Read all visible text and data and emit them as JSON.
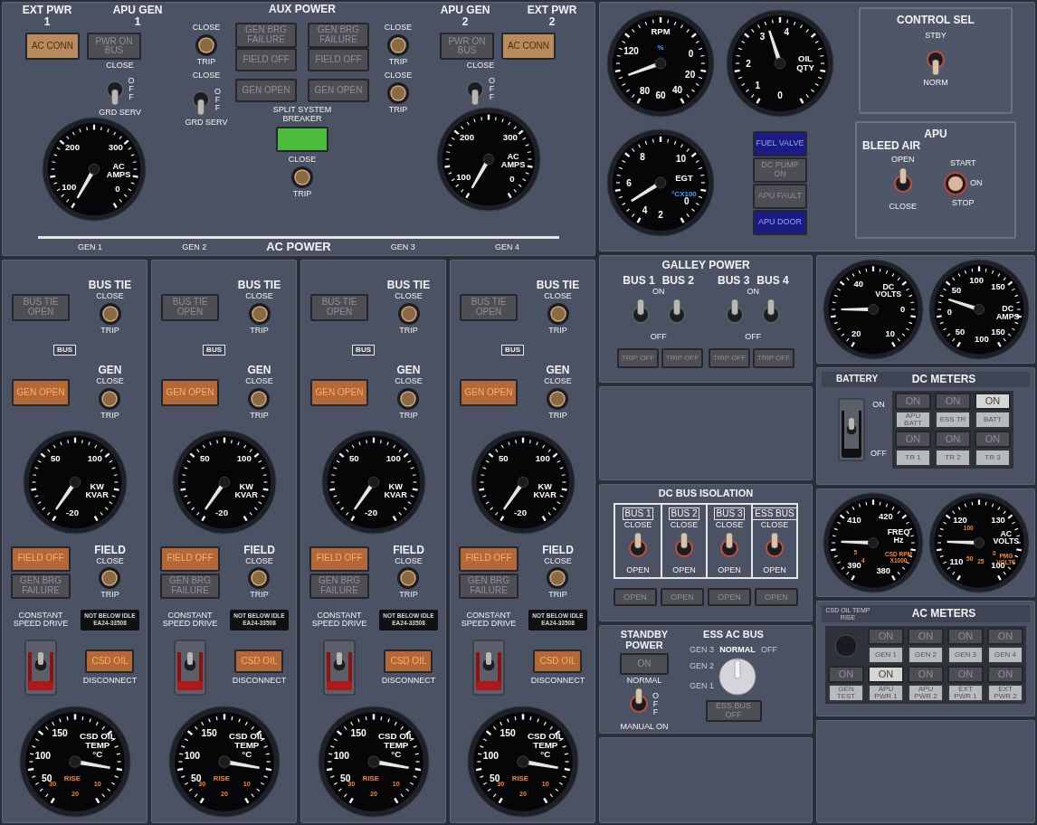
{
  "aux_power": {
    "title": "AUX POWER",
    "left": {
      "headings": [
        "EXT PWR 1",
        "APU GEN 1"
      ],
      "lights": [
        {
          "text": "AC CONN",
          "lit": true
        },
        {
          "text": "PWR ON BUS",
          "lit": false
        }
      ],
      "switch": {
        "top": "CLOSE",
        "side": "OFF",
        "bottom": "GRD SERV",
        "up": false
      },
      "gauge": {
        "caption": [
          "AC",
          "AMPS"
        ],
        "labels": [
          "200",
          "300",
          "100",
          "0"
        ]
      }
    },
    "inner_left": {
      "breaker": {
        "top": "CLOSE",
        "bottom": "TRIP"
      },
      "switch": {
        "top": "CLOSE",
        "side": "OFF",
        "bottom": "GRD SERV",
        "up": false
      }
    },
    "center": {
      "light_columns": [
        [
          {
            "text": "GEN BRG FAILURE",
            "lit": false
          },
          {
            "text": "FIELD OFF",
            "lit": false
          },
          {
            "text": "GEN OPEN",
            "lit": false
          }
        ],
        [
          {
            "text": "GEN BRG FAILURE",
            "lit": false
          },
          {
            "text": "FIELD OFF",
            "lit": false
          },
          {
            "text": "GEN OPEN",
            "lit": false
          }
        ]
      ],
      "breaker_label": "SPLIT SYSTEM BREAKER",
      "breaker_lit": true,
      "breaker": {
        "top": "CLOSE",
        "bottom": "TRIP"
      }
    },
    "inner_right": {
      "breakers": [
        {
          "top": "CLOSE",
          "bottom": "TRIP"
        },
        {
          "top": "CLOSE",
          "bottom": "TRIP"
        }
      ]
    },
    "right": {
      "headings": [
        "APU GEN 2",
        "EXT PWR 2"
      ],
      "lights": [
        {
          "text": "PWR ON BUS",
          "lit": false
        },
        {
          "text": "AC CONN",
          "lit": true
        }
      ],
      "switch": {
        "top": "CLOSE",
        "side": "OFF",
        "up": false
      },
      "gauge": {
        "caption": [
          "AC",
          "AMPS"
        ],
        "labels": [
          "200",
          "300",
          "100",
          "0"
        ]
      }
    },
    "bus_labels": [
      "GEN 1",
      "GEN 2",
      "GEN 3",
      "GEN 4"
    ],
    "footer": "AC POWER"
  },
  "generators": [
    {
      "bus_tie": {
        "title": "BUS TIE",
        "top": "CLOSE",
        "bottom": "TRIP",
        "light": {
          "text": "BUS TIE OPEN",
          "lit": false
        }
      },
      "bus_tag": "BUS",
      "gen": {
        "title": "GEN",
        "top": "CLOSE",
        "bottom": "TRIP",
        "light": {
          "text": "GEN OPEN",
          "lit": true
        }
      },
      "gauge": {
        "caption": [
          "KW",
          "KVAR"
        ],
        "labels": [
          "50",
          "100",
          "-20"
        ]
      },
      "field": {
        "title": "FIELD",
        "top": "CLOSE",
        "bottom": "TRIP",
        "light": {
          "text": "FIELD OFF",
          "lit": true
        }
      },
      "failure_light": {
        "text": "GEN BRG FAILURE",
        "lit": false
      },
      "csd_label": "CONSTANT SPEED DRIVE",
      "placard": [
        "NOT BELOW IDLE",
        "EA24-33508"
      ],
      "csd_light": {
        "text": "CSD OIL",
        "lit": true
      },
      "disconnect": {
        "label": "DISCONNECT",
        "up": true
      },
      "temp_gauge": {
        "caption": [
          "CSD OIL",
          "TEMP",
          "°C"
        ],
        "labels": [
          "50",
          "100",
          "150"
        ],
        "inner_labels": [
          "30",
          "20",
          "10"
        ],
        "inner_caption": "RISE"
      }
    },
    {
      "bus_tie": {
        "title": "BUS TIE",
        "top": "CLOSE",
        "bottom": "TRIP",
        "light": {
          "text": "BUS TIE OPEN",
          "lit": false
        }
      },
      "bus_tag": "BUS",
      "gen": {
        "title": "GEN",
        "top": "CLOSE",
        "bottom": "TRIP",
        "light": {
          "text": "GEN OPEN",
          "lit": true
        }
      },
      "gauge": {
        "caption": [
          "KW",
          "KVAR"
        ],
        "labels": [
          "50",
          "100",
          "-20"
        ]
      },
      "field": {
        "title": "FIELD",
        "top": "CLOSE",
        "bottom": "TRIP",
        "light": {
          "text": "FIELD OFF",
          "lit": true
        }
      },
      "failure_light": {
        "text": "GEN BRG FAILURE",
        "lit": false
      },
      "csd_label": "CONSTANT SPEED DRIVE",
      "placard": [
        "NOT BELOW IDLE",
        "EA24-33508"
      ],
      "csd_light": {
        "text": "CSD OIL",
        "lit": true
      },
      "disconnect": {
        "label": "DISCONNECT",
        "up": true
      },
      "temp_gauge": {
        "caption": [
          "CSD OIL",
          "TEMP",
          "°C"
        ],
        "labels": [
          "50",
          "100",
          "150"
        ],
        "inner_labels": [
          "30",
          "20",
          "10"
        ],
        "inner_caption": "RISE"
      }
    },
    {
      "bus_tie": {
        "title": "BUS TIE",
        "top": "CLOSE",
        "bottom": "TRIP",
        "light": {
          "text": "BUS TIE OPEN",
          "lit": false
        }
      },
      "bus_tag": "BUS",
      "gen": {
        "title": "GEN",
        "top": "CLOSE",
        "bottom": "TRIP",
        "light": {
          "text": "GEN OPEN",
          "lit": true
        }
      },
      "gauge": {
        "caption": [
          "KW",
          "KVAR"
        ],
        "labels": [
          "50",
          "100",
          "-20"
        ]
      },
      "field": {
        "title": "FIELD",
        "top": "CLOSE",
        "bottom": "TRIP",
        "light": {
          "text": "FIELD OFF",
          "lit": true
        }
      },
      "failure_light": {
        "text": "GEN BRG FAILURE",
        "lit": false
      },
      "csd_label": "CONSTANT SPEED DRIVE",
      "placard": [
        "NOT BELOW IDLE",
        "EA24-33508"
      ],
      "csd_light": {
        "text": "CSD OIL",
        "lit": true
      },
      "disconnect": {
        "label": "DISCONNECT",
        "up": true
      },
      "temp_gauge": {
        "caption": [
          "CSD OIL",
          "TEMP",
          "°C"
        ],
        "labels": [
          "50",
          "100",
          "150"
        ],
        "inner_labels": [
          "30",
          "20",
          "10"
        ],
        "inner_caption": "RISE"
      }
    },
    {
      "bus_tie": {
        "title": "BUS TIE",
        "top": "CLOSE",
        "bottom": "TRIP",
        "light": {
          "text": "BUS TIE OPEN",
          "lit": false
        }
      },
      "bus_tag": "BUS",
      "gen": {
        "title": "GEN",
        "top": "CLOSE",
        "bottom": "TRIP",
        "light": {
          "text": "GEN OPEN",
          "lit": true
        }
      },
      "gauge": {
        "caption": [
          "KW",
          "KVAR"
        ],
        "labels": [
          "50",
          "100",
          "-20"
        ]
      },
      "field": {
        "title": "FIELD",
        "top": "CLOSE",
        "bottom": "TRIP",
        "light": {
          "text": "FIELD OFF",
          "lit": true
        }
      },
      "failure_light": {
        "text": "GEN BRG FAILURE",
        "lit": false
      },
      "csd_label": "CONSTANT SPEED DRIVE",
      "placard": [
        "NOT BELOW IDLE",
        "EA24-33508"
      ],
      "csd_light": {
        "text": "CSD OIL",
        "lit": true
      },
      "disconnect": {
        "label": "DISCONNECT",
        "up": true
      },
      "temp_gauge": {
        "caption": [
          "CSD OIL",
          "TEMP",
          "°C"
        ],
        "labels": [
          "50",
          "100",
          "150"
        ],
        "inner_labels": [
          "30",
          "20",
          "10"
        ],
        "inner_caption": "RISE"
      }
    }
  ],
  "apu": {
    "gauges": [
      {
        "caption": [
          "RPM"
        ],
        "unit": [
          "%"
        ],
        "labels": [
          "80",
          "120",
          "0",
          "20",
          "40",
          "60"
        ]
      },
      {
        "caption": [
          "OIL",
          "QTY"
        ],
        "labels": [
          "1",
          "2",
          "3",
          "4",
          "0"
        ]
      },
      {
        "caption": [
          "EGT"
        ],
        "unit": [
          "°CX100"
        ],
        "labels": [
          "4",
          "6",
          "8",
          "10",
          "0",
          "2"
        ]
      }
    ],
    "lights": [
      {
        "text": "FUEL VALVE",
        "lit": true
      },
      {
        "text": "DC PUMP ON",
        "lit": false
      },
      {
        "text": "APU FAULT",
        "lit": false
      },
      {
        "text": "APU DOOR",
        "lit": true
      }
    ],
    "control_sel": {
      "title": "CONTROL SEL",
      "switch": {
        "top": "STBY",
        "bottom": "NORM",
        "up": false
      }
    },
    "bleed": {
      "title": "APU",
      "subtitle": "BLEED AIR",
      "switch": {
        "top": "OPEN",
        "bottom": "CLOSE",
        "up": true
      },
      "start": {
        "top": "START",
        "side": "ON",
        "bottom": "STOP"
      }
    }
  },
  "galley": {
    "title": "GALLEY POWER",
    "groups": [
      {
        "buses": [
          "BUS 1",
          "BUS 2"
        ],
        "on": "ON",
        "off": "OFF",
        "switches": [
          {
            "up": true
          },
          {
            "up": true
          }
        ],
        "lights": [
          {
            "text": "TRIP OFF",
            "lit": false
          },
          {
            "text": "TRIP OFF",
            "lit": false
          }
        ]
      },
      {
        "buses": [
          "BUS 3",
          "BUS 4"
        ],
        "on": "ON",
        "off": "OFF",
        "switches": [
          {
            "up": true
          },
          {
            "up": true
          }
        ],
        "lights": [
          {
            "text": "TRIP OFF",
            "lit": false
          },
          {
            "text": "TRIP OFF",
            "lit": false
          }
        ]
      }
    ]
  },
  "dc_isolation": {
    "title": "DC BUS ISOLATION",
    "buses": [
      {
        "name": "BUS 1",
        "top": "CLOSE",
        "bottom": "OPEN",
        "up": true,
        "light": {
          "text": "OPEN",
          "lit": false
        }
      },
      {
        "name": "BUS 2",
        "top": "CLOSE",
        "bottom": "OPEN",
        "up": true,
        "light": {
          "text": "OPEN",
          "lit": false
        }
      },
      {
        "name": "BUS 3",
        "top": "CLOSE",
        "bottom": "OPEN",
        "up": true,
        "light": {
          "text": "OPEN",
          "lit": false
        }
      },
      {
        "name": "ESS BUS",
        "top": "CLOSE",
        "bottom": "OPEN",
        "up": true,
        "light": {
          "text": "OPEN",
          "lit": false
        }
      }
    ]
  },
  "standby": {
    "title": "STANDBY POWER",
    "light": {
      "text": "ON",
      "lit": false
    },
    "switch": {
      "top": "NORMAL",
      "side": "OFF",
      "bottom": "MANUAL ON",
      "up": true
    }
  },
  "ess_ac_bus": {
    "title": "ESS AC BUS",
    "positions": [
      {
        "label": "GEN 3",
        "selected": false
      },
      {
        "label": "NORMAL",
        "selected": true
      },
      {
        "label": "OFF",
        "selected": false
      },
      {
        "label": "GEN 2",
        "selected": false
      },
      {
        "label": "GEN 1",
        "selected": false
      }
    ],
    "light": {
      "text": "ESS BUS OFF",
      "lit": false
    }
  },
  "dc_gauges": [
    {
      "caption": [
        "DC",
        "VOLTS"
      ],
      "labels": [
        "20",
        "40",
        "0",
        "10"
      ]
    },
    {
      "caption": [
        "DC",
        "AMPS"
      ],
      "labels": [
        "50",
        "0",
        "50",
        "100",
        "150",
        "150",
        "100"
      ]
    }
  ],
  "dc_meters": {
    "title": "DC METERS",
    "battery": {
      "label": "BATTERY",
      "on": "ON",
      "off": "OFF",
      "up": true
    },
    "cells": [
      {
        "lamp": "ON",
        "lit": false,
        "label": "APU BATT"
      },
      {
        "lamp": "ON",
        "lit": false,
        "label": "ESS TR"
      },
      {
        "lamp": "ON",
        "lit": true,
        "label": "BATT"
      },
      {
        "lamp": "ON",
        "lit": false,
        "label": "TR 1"
      },
      {
        "lamp": "ON",
        "lit": false,
        "label": "TR 2"
      },
      {
        "lamp": "ON",
        "lit": false,
        "label": "TR 3"
      }
    ]
  },
  "ac_gauges": [
    {
      "caption": [
        "FREQ",
        "Hz"
      ],
      "alt_caption": [
        "CSD RPM",
        "X1000"
      ],
      "labels": [
        "410",
        "420",
        "390",
        "380"
      ],
      "inner_labels": [
        "4",
        "5"
      ]
    },
    {
      "caption": [
        "AC",
        "VOLTS"
      ],
      "alt_caption": [
        "PMG",
        "VOLTS"
      ],
      "labels": [
        "120",
        "130",
        "110",
        "100"
      ],
      "inner_labels": [
        "50",
        "100",
        "0",
        "25"
      ]
    }
  ],
  "ac_meters": {
    "title": "AC METERS",
    "knob_label": "CSD OIL TEMP RISE",
    "cells": [
      {
        "lamp": "ON",
        "lit": false,
        "label": "GEN 1"
      },
      {
        "lamp": "ON",
        "lit": false,
        "label": "GEN 2"
      },
      {
        "lamp": "ON",
        "lit": false,
        "label": "GEN 3"
      },
      {
        "lamp": "ON",
        "lit": false,
        "label": "GEN 4"
      },
      {
        "lamp": "ON",
        "lit": false,
        "label": "GEN TEST"
      },
      {
        "lamp": "ON",
        "lit": true,
        "label": "APU PWR 1"
      },
      {
        "lamp": "ON",
        "lit": false,
        "label": "APU PWR 2"
      },
      {
        "lamp": "ON",
        "lit": false,
        "label": "EXT PWR 1"
      },
      {
        "lamp": "ON",
        "lit": false,
        "label": "EXT PWR 2"
      }
    ]
  }
}
